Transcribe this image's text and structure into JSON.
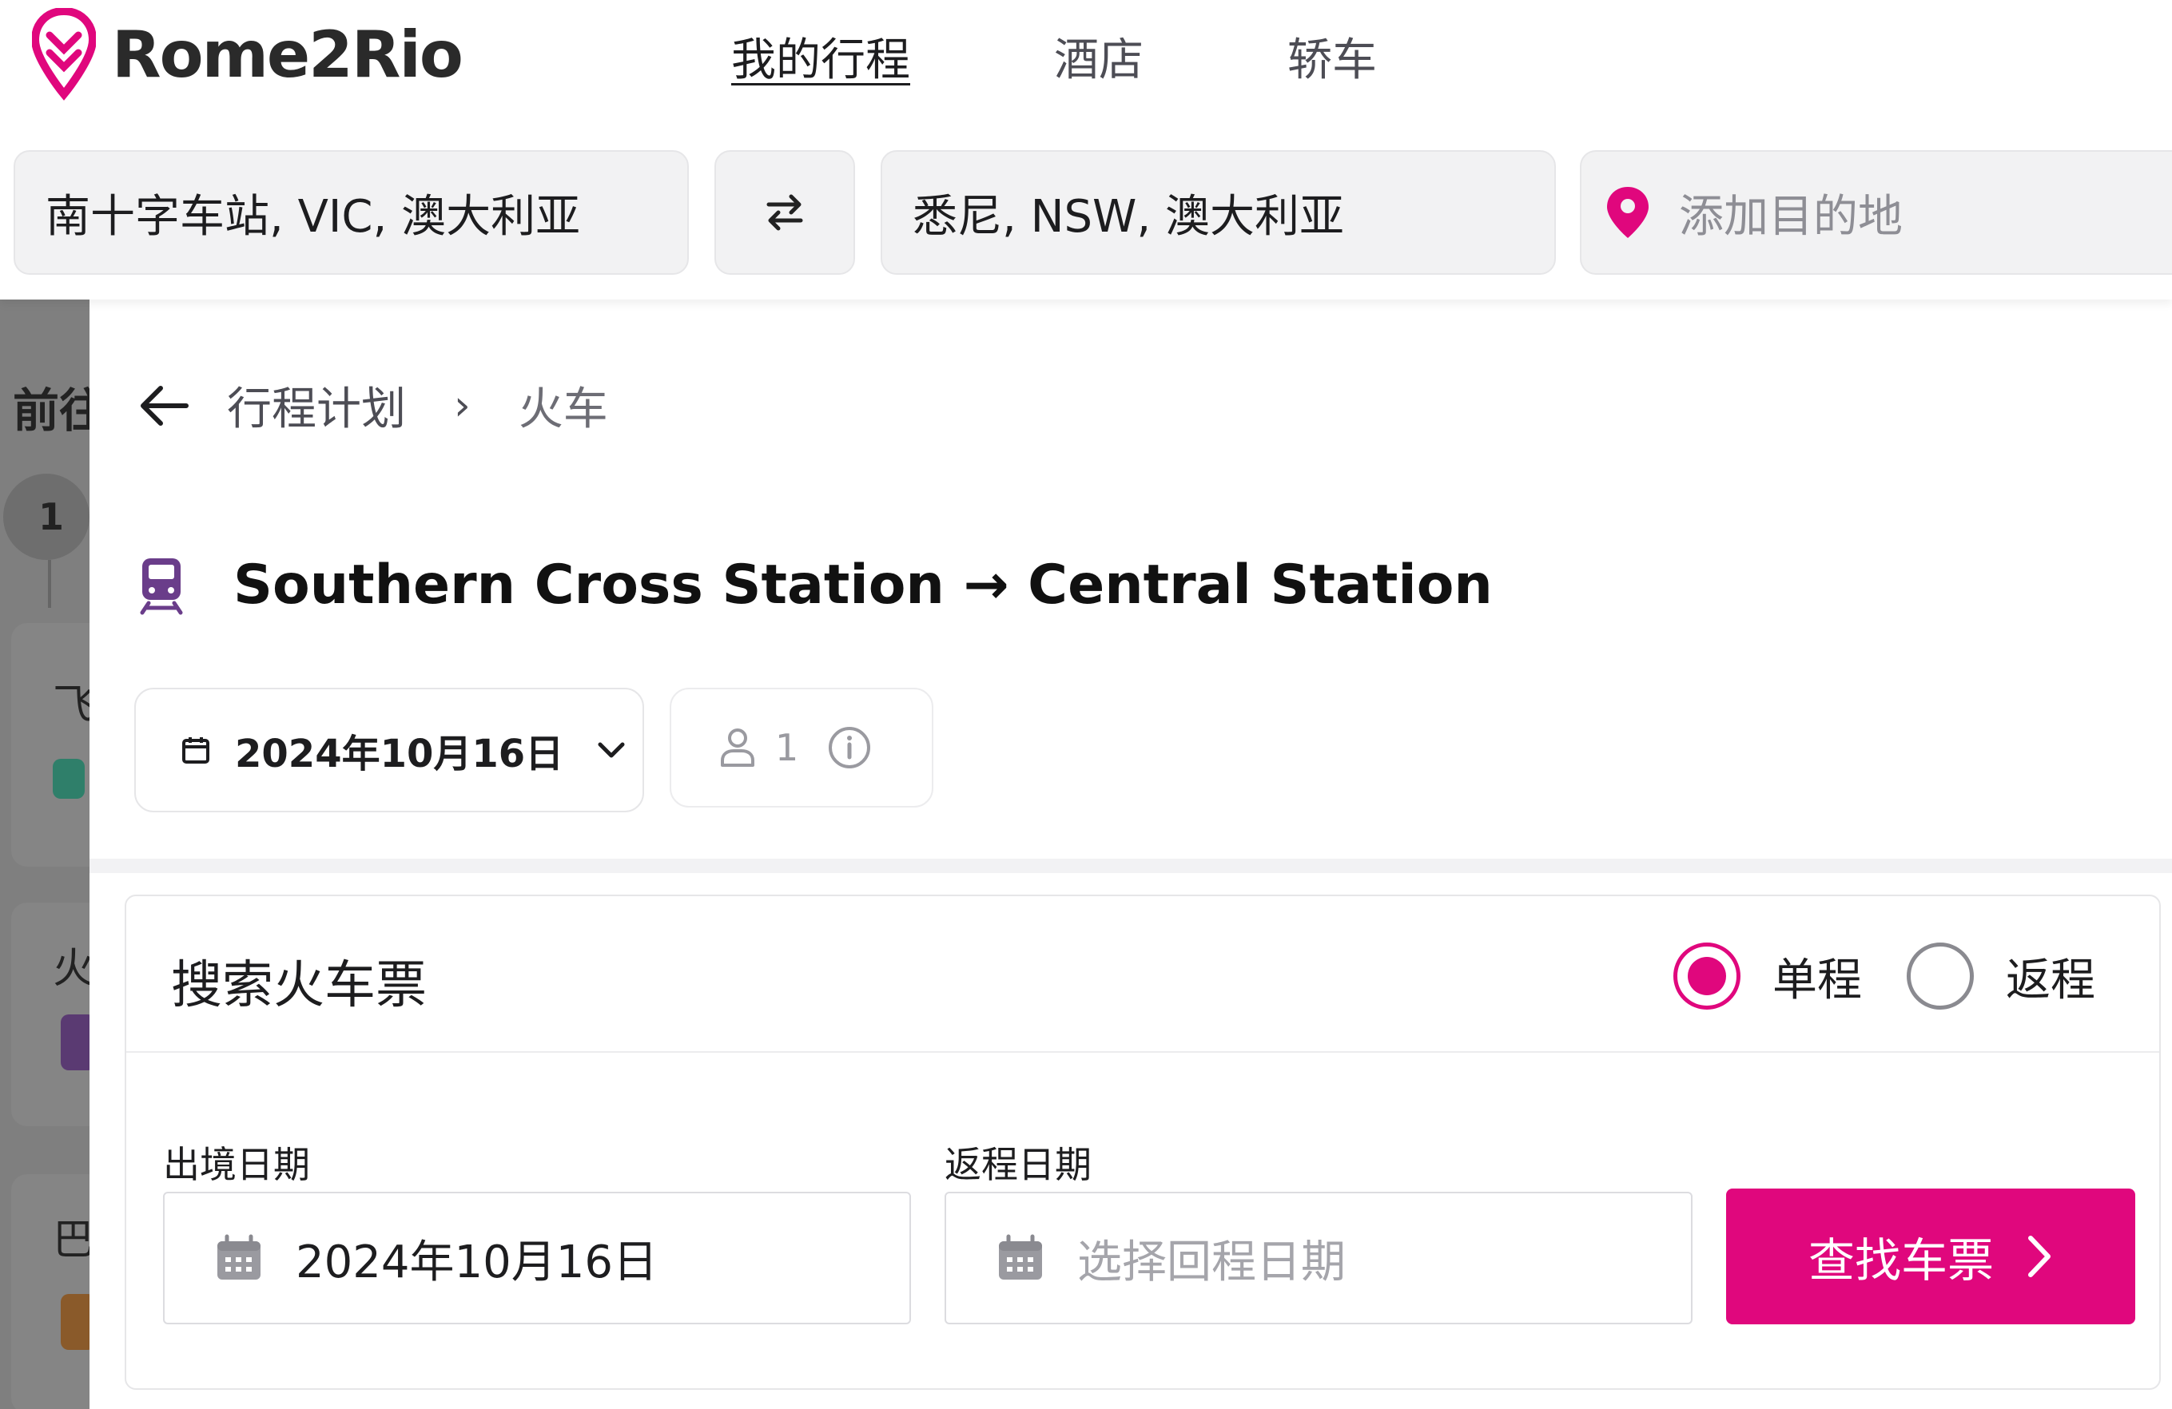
{
  "brand": {
    "name": "Rome2Rio",
    "accent": "#e0077d"
  },
  "nav": {
    "items": [
      {
        "label": "我的行程",
        "active": true
      },
      {
        "label": "酒店",
        "active": false
      },
      {
        "label": "轿车",
        "active": false
      }
    ]
  },
  "search": {
    "origin": "南十字车站, VIC, 澳大利亚",
    "destination": "悉尼, NSW, 澳大利亚",
    "add_destination_placeholder": "添加目的地",
    "swap_icon": "swap-arrows-icon"
  },
  "background_panel": {
    "title": "前往",
    "step_number": "1",
    "card_labels": [
      "飞",
      "火",
      "巴"
    ]
  },
  "breadcrumb": {
    "back_icon": "arrow-left-icon",
    "parent": "行程计划",
    "separator": "›",
    "current": "火车"
  },
  "route": {
    "icon": "train-icon",
    "title": "Southern Cross Station → Central Station"
  },
  "trip_filters": {
    "date": "2024年10月16日",
    "passengers": "1"
  },
  "ticket_search": {
    "title": "搜索火车票",
    "trip_types": [
      {
        "label": "单程",
        "selected": true
      },
      {
        "label": "返程",
        "selected": false
      }
    ],
    "departure_label": "出境日期",
    "departure_value": "2024年10月16日",
    "return_label": "返程日期",
    "return_placeholder": "选择回程日期",
    "submit_label": "查找车票"
  }
}
